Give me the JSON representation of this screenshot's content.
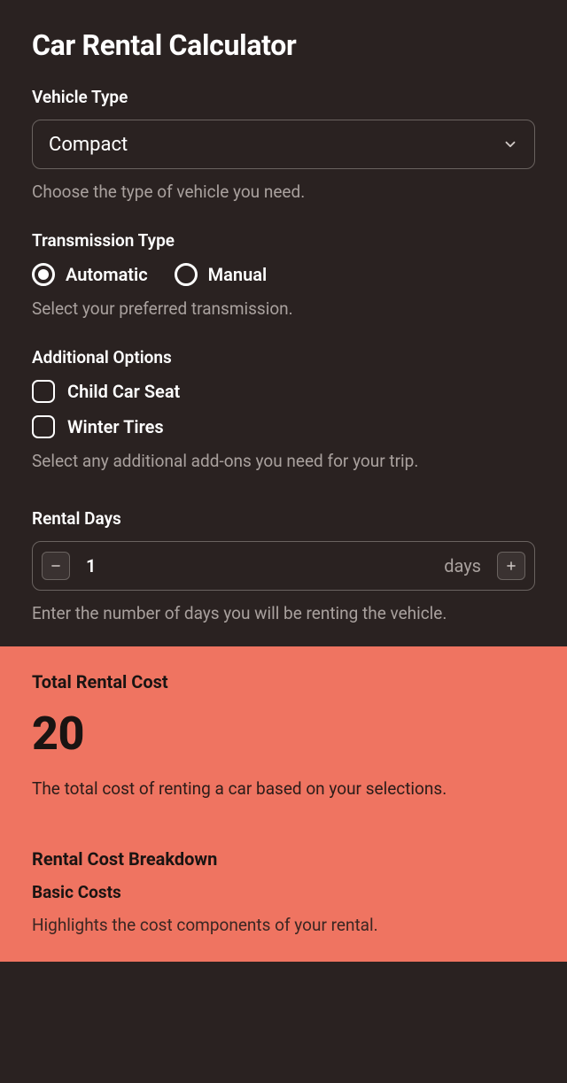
{
  "title": "Car Rental Calculator",
  "vehicle": {
    "label": "Vehicle Type",
    "selected": "Compact",
    "helper": "Choose the type of vehicle you need."
  },
  "transmission": {
    "label": "Transmission Type",
    "options": [
      {
        "label": "Automatic",
        "selected": true
      },
      {
        "label": "Manual",
        "selected": false
      }
    ],
    "helper": "Select your preferred transmission."
  },
  "addons": {
    "label": "Additional Options",
    "options": [
      {
        "label": "Child Car Seat",
        "checked": false
      },
      {
        "label": "Winter Tires",
        "checked": false
      }
    ],
    "helper": "Select any additional add-ons you need for your trip."
  },
  "days": {
    "label": "Rental Days",
    "value": "1",
    "unit": "days",
    "helper": "Enter the number of days you will be renting the vehicle."
  },
  "result": {
    "title": "Total Rental Cost",
    "value": "20",
    "desc": "The total cost of renting a car based on your selections.",
    "breakdown_title": "Rental Cost Breakdown",
    "breakdown_sub": "Basic Costs",
    "breakdown_desc": "Highlights the cost components of your rental."
  }
}
